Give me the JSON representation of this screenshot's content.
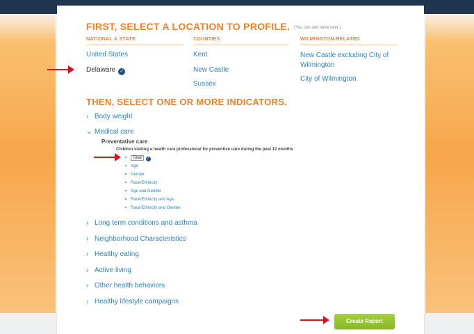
{
  "locations_heading": "FIRST, SELECT A LOCATION TO PROFILE.",
  "locations_note": "(You can add more later.)",
  "columns": {
    "national_state": {
      "header": "NATIONAL & STATE",
      "items": [
        "United States",
        "Delaware"
      ]
    },
    "counties": {
      "header": "COUNTIES",
      "items": [
        "Kent",
        "New Castle",
        "Sussex"
      ]
    },
    "wilmington": {
      "header": "WILMINGTON-RELATED",
      "items": [
        "New Castle excluding City of Wilmington",
        "City of Wilmington"
      ]
    }
  },
  "selected_location": "Delaware",
  "indicators_heading": "THEN, SELECT ONE OR MORE INDICATORS.",
  "categories": [
    "Body weight",
    "Medical care",
    "Long term conditions and asthma",
    "Neighborhood Characteristics",
    "Healthy eating",
    "Active living",
    "Other health behaviors",
    "Healthy lifestyle campaigns"
  ],
  "expanded_category": "Medical care",
  "subcategory": "Preventative care",
  "indicator": "Children visiting a health care professional for preventive care during the past 12 months",
  "breakdowns": [
    "Total",
    "Age",
    "Gender",
    "Race/Ethnicity",
    "Age and Gender",
    "Race/Ethnicity and Age",
    "Race/Ethnicity and Gender"
  ],
  "selected_breakdown": "Total",
  "create_report_label": "Create Report",
  "colors": {
    "accent_orange": "#f07f27",
    "link_blue": "#2a84c6",
    "check_navy": "#1e4f86",
    "button_green": "#95c534",
    "arrow_red": "#e0111b"
  },
  "icons": [
    "check-circle-icon",
    "chevron-right-icon",
    "chevron-down-icon",
    "arrow-right-icon"
  ]
}
